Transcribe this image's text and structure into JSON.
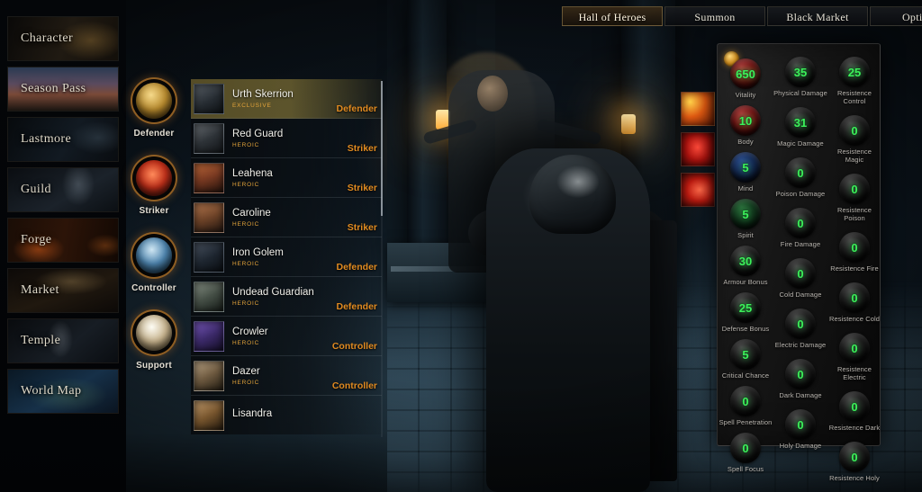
{
  "topnav": {
    "tabs": [
      {
        "label": "Hall of Heroes",
        "active": true
      },
      {
        "label": "Summon",
        "active": false
      },
      {
        "label": "Black Market",
        "active": false
      },
      {
        "label": "Options",
        "active": false
      }
    ]
  },
  "sidebar": {
    "items": [
      {
        "label": "Character",
        "art": "art-character"
      },
      {
        "label": "Season Pass",
        "art": "art-season"
      },
      {
        "label": "Lastmore",
        "art": "art-lastmore"
      },
      {
        "label": "Guild",
        "art": "art-guild"
      },
      {
        "label": "Forge",
        "art": "art-forge"
      },
      {
        "label": "Market",
        "art": "art-market"
      },
      {
        "label": "Temple",
        "art": "art-temple"
      },
      {
        "label": "World Map",
        "art": "art-worldmap"
      }
    ]
  },
  "class_filters": [
    {
      "label": "Defender",
      "orb": "o-defender"
    },
    {
      "label": "Striker",
      "orb": "o-striker"
    },
    {
      "label": "Controller",
      "orb": "o-controller"
    },
    {
      "label": "Support",
      "orb": "o-support"
    }
  ],
  "hero_list": {
    "selected_index": 0,
    "heroes": [
      {
        "name": "Urth Skerrion",
        "rarity": "Exclusive",
        "class": "Defender",
        "portrait": "p-urth"
      },
      {
        "name": "Red Guard",
        "rarity": "Heroic",
        "class": "Striker",
        "portrait": "p-red"
      },
      {
        "name": "Leahena",
        "rarity": "Heroic",
        "class": "Striker",
        "portrait": "p-lea"
      },
      {
        "name": "Caroline",
        "rarity": "Heroic",
        "class": "Striker",
        "portrait": "p-car"
      },
      {
        "name": "Iron Golem",
        "rarity": "Heroic",
        "class": "Defender",
        "portrait": "p-iron"
      },
      {
        "name": "Undead Guardian",
        "rarity": "Heroic",
        "class": "Defender",
        "portrait": "p-und"
      },
      {
        "name": "Crowler",
        "rarity": "Heroic",
        "class": "Controller",
        "portrait": "p-crow"
      },
      {
        "name": "Dazer",
        "rarity": "Heroic",
        "class": "Controller",
        "portrait": "p-daz"
      },
      {
        "name": "Lisandra",
        "rarity": "",
        "class": "",
        "portrait": "p-lis"
      }
    ]
  },
  "abilities": [
    {
      "name": "fire-weapon-icon",
      "art": "ab-1"
    },
    {
      "name": "red-demon-icon",
      "art": "ab-2"
    },
    {
      "name": "blood-swirl-icon",
      "art": "ab-3"
    }
  ],
  "stats_panel": {
    "currency_icon": "gold-coin-icon",
    "column_attributes": [
      {
        "label": "Vitality",
        "value": "650",
        "style": "vital"
      },
      {
        "label": "Body",
        "value": "10",
        "style": "vital"
      },
      {
        "label": "Mind",
        "value": "5",
        "style": "mind"
      },
      {
        "label": "Spirit",
        "value": "5",
        "style": "spirit"
      },
      {
        "label": "Armour Bonus",
        "value": "30",
        "style": ""
      },
      {
        "label": "Defense Bonus",
        "value": "25",
        "style": ""
      },
      {
        "label": "Critical Chance",
        "value": "5",
        "style": ""
      },
      {
        "label": "Spell Penetration",
        "value": "0",
        "style": ""
      },
      {
        "label": "Spell Focus",
        "value": "0",
        "style": ""
      }
    ],
    "column_damage": [
      {
        "label": "Physical Damage",
        "value": "35"
      },
      {
        "label": "Magic Damage",
        "value": "31"
      },
      {
        "label": "Poison Damage",
        "value": "0"
      },
      {
        "label": "Fire Damage",
        "value": "0"
      },
      {
        "label": "Cold Damage",
        "value": "0"
      },
      {
        "label": "Electric Damage",
        "value": "0"
      },
      {
        "label": "Dark Damage",
        "value": "0"
      },
      {
        "label": "Holy Damage",
        "value": "0"
      }
    ],
    "column_resistence": [
      {
        "label": "Resistence Control",
        "value": "25"
      },
      {
        "label": "Resistence Magic",
        "value": "0"
      },
      {
        "label": "Resistence Poison",
        "value": "0"
      },
      {
        "label": "Resistence Fire",
        "value": "0"
      },
      {
        "label": "Resistence Cold",
        "value": "0"
      },
      {
        "label": "Resistence Electric",
        "value": "0"
      },
      {
        "label": "Resistence Dark",
        "value": "0"
      },
      {
        "label": "Resistence Holy",
        "value": "0"
      }
    ]
  },
  "colors": {
    "stat_value_green": "#3cf05a",
    "class_orange": "#e08a20",
    "rarity_gold": "#e4a43a",
    "selection_olive": "#7c6e34"
  }
}
